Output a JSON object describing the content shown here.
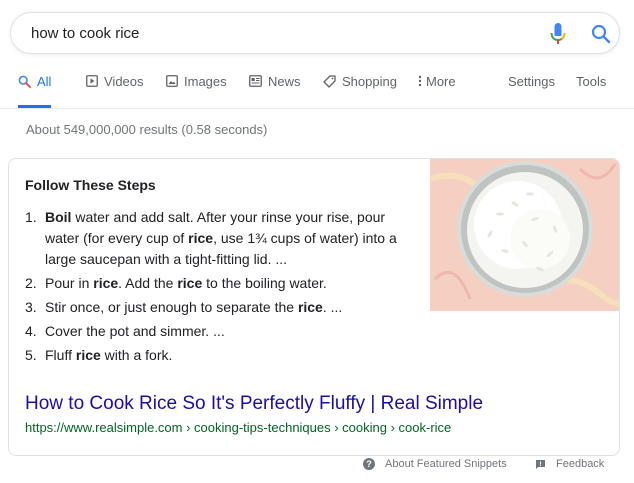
{
  "search": {
    "value": "how to cook rice",
    "placeholder": ""
  },
  "tabs": [
    {
      "label": "All",
      "icon": "search-icon",
      "active": true
    },
    {
      "label": "Videos",
      "icon": "play-icon"
    },
    {
      "label": "Images",
      "icon": "image-icon"
    },
    {
      "label": "News",
      "icon": "newspaper-icon"
    },
    {
      "label": "Shopping",
      "icon": "tag-icon"
    },
    {
      "label": "More",
      "icon": "more-vertical-icon"
    }
  ],
  "tools": {
    "settings": "Settings",
    "tools": "Tools"
  },
  "results_stats": "About 549,000,000 results (0.58 seconds)",
  "snippet": {
    "heading": "Follow These Steps",
    "steps": [
      {
        "num": "1.",
        "parts": [
          "Boil",
          " water and add salt. After your rinse your rise, pour water (for every cup of ",
          "rice",
          ", use 1¾ cups of water) into a large saucepan with a tight-fitting lid. ..."
        ]
      },
      {
        "num": "2.",
        "parts": [
          "Pour in ",
          "rice",
          ". Add the ",
          "rice",
          " to the boiling water."
        ]
      },
      {
        "num": "3.",
        "parts": [
          "Stir once, or just enough to separate the ",
          "rice",
          ". ..."
        ]
      },
      {
        "num": "4.",
        "parts": [
          "Cover the pot and simmer. ..."
        ]
      },
      {
        "num": "5.",
        "parts": [
          "Fluff ",
          "rice",
          " with a fork."
        ]
      }
    ],
    "image_icon": "rice-bowl-photo",
    "result_title": "How to Cook Rice So It's Perfectly Fluffy | Real Simple",
    "result_url": "https://www.realsimple.com › cooking-tips-techniques › cooking › cook-rice"
  },
  "footer": {
    "about": "About Featured Snippets",
    "feedback": "Feedback"
  },
  "colors": {
    "link": "#1a0dab",
    "url": "#006621",
    "accent": "#1a73e8"
  }
}
